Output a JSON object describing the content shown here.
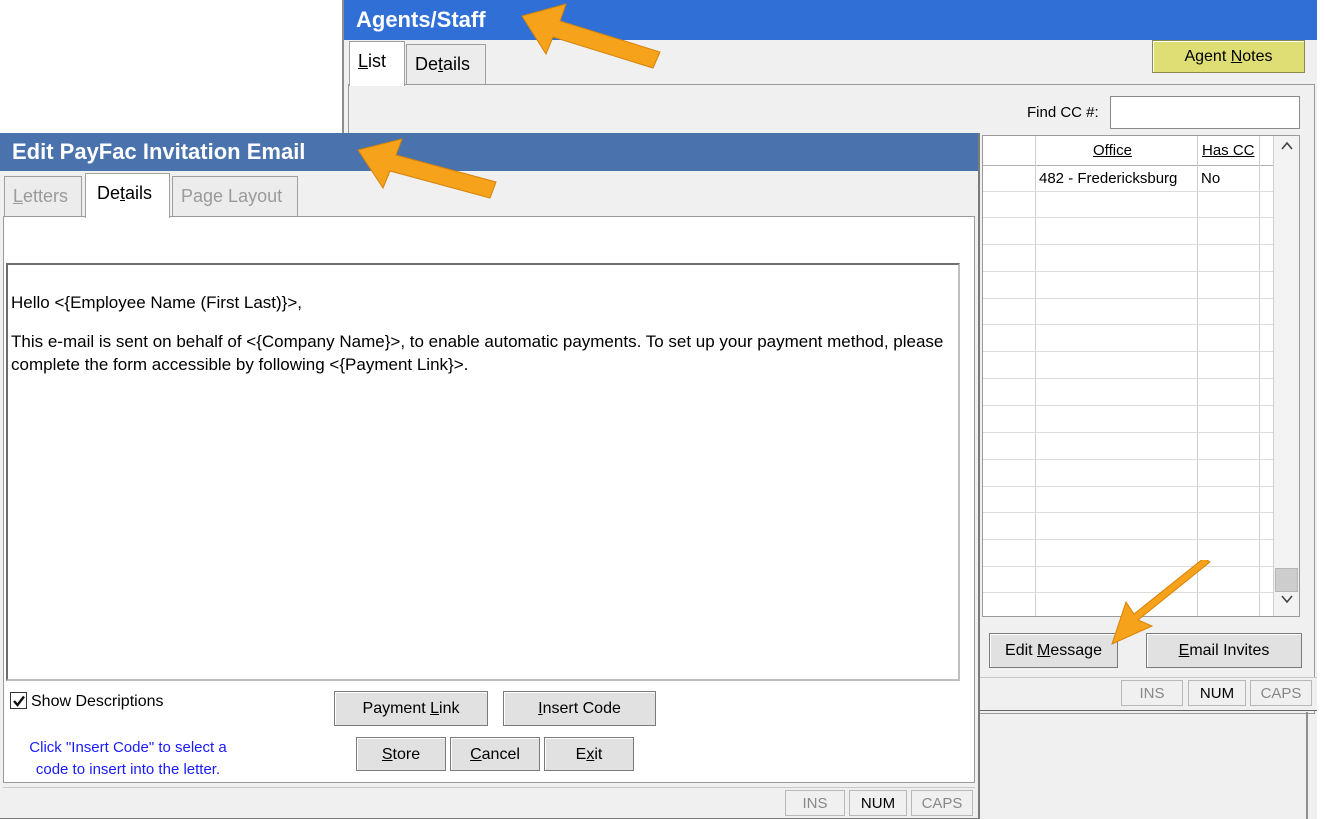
{
  "agents_window": {
    "title": "Agents/Staff",
    "tabs": [
      {
        "label_pre": "",
        "label_ul": "L",
        "label_post": "ist"
      },
      {
        "label_pre": "De",
        "label_ul": "t",
        "label_post": "ails"
      }
    ],
    "agent_notes": {
      "pre": "Agent ",
      "ul": "N",
      "post": "otes"
    },
    "find_cc_label": "Find CC #:",
    "find_cc_value": "",
    "grid": {
      "columns": [
        "Office",
        "Has CC"
      ],
      "rows": [
        {
          "office": "482 - Fredericksburg",
          "has_cc": "No"
        }
      ]
    },
    "edit_message": {
      "pre": "Edit ",
      "ul": "M",
      "post": "essage"
    },
    "email_invites": {
      "pre": "",
      "ul": "E",
      "post": "mail Invites"
    },
    "status": {
      "ins": "INS",
      "num": "NUM",
      "caps": "CAPS"
    }
  },
  "email_window": {
    "title": "Edit PayFac Invitation Email",
    "tabs": [
      {
        "label_pre": "",
        "label_ul": "L",
        "label_post": "etters"
      },
      {
        "label_pre": "De",
        "label_ul": "t",
        "label_post": "ails"
      },
      {
        "label_pre": "Pa",
        "label_ul": "g",
        "label_post": "e Layout"
      }
    ],
    "body_line1": "Hello <{Employee Name (First Last)}>,",
    "body_line2": "This e-mail is sent on behalf of <{Company Name}>, to enable automatic payments. To set up your payment method, please complete the form accessible by following  <{Payment Link}>.",
    "show_descriptions_label": "Show Descriptions",
    "show_descriptions_checked": true,
    "help_text": "Click \"Insert Code\" to select a code to insert into the letter.",
    "payment_link": {
      "pre": "Payment ",
      "ul": "L",
      "post": "ink"
    },
    "insert_code": {
      "pre": "",
      "ul": "I",
      "post": "nsert Code"
    },
    "store": {
      "pre": "",
      "ul": "S",
      "post": "tore"
    },
    "cancel": {
      "pre": "",
      "ul": "C",
      "post": "ancel"
    },
    "exit": {
      "pre": "E",
      "ul": "x",
      "post": "it"
    },
    "status": {
      "ins": "INS",
      "num": "NUM",
      "caps": "CAPS"
    }
  },
  "colors": {
    "agents_title_bg": "#2f6fd6",
    "email_title_bg": "#4a73ae",
    "agent_notes_bg": "#dede74",
    "help_text": "#1a1aff",
    "arrow": "#f7a21b"
  },
  "icons": [
    "checkmark-icon",
    "scroll-up-icon",
    "scroll-down-icon",
    "pointer-arrow-icon"
  ]
}
